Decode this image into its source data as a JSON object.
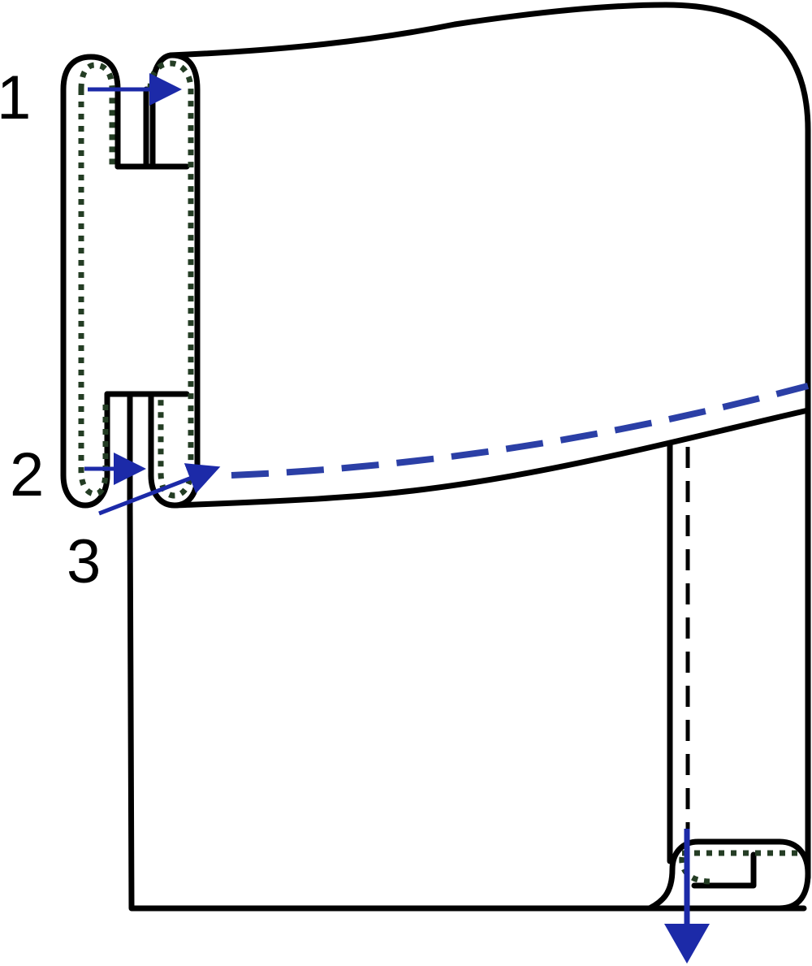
{
  "diagram": {
    "labels": {
      "step1": "1",
      "step2": "2",
      "step3": "3"
    },
    "colors": {
      "outline": "#000000",
      "dotted_line": "#243d24",
      "arrow": "#1c2aa8",
      "dashed_fold_line": "#2b3fa6"
    }
  }
}
